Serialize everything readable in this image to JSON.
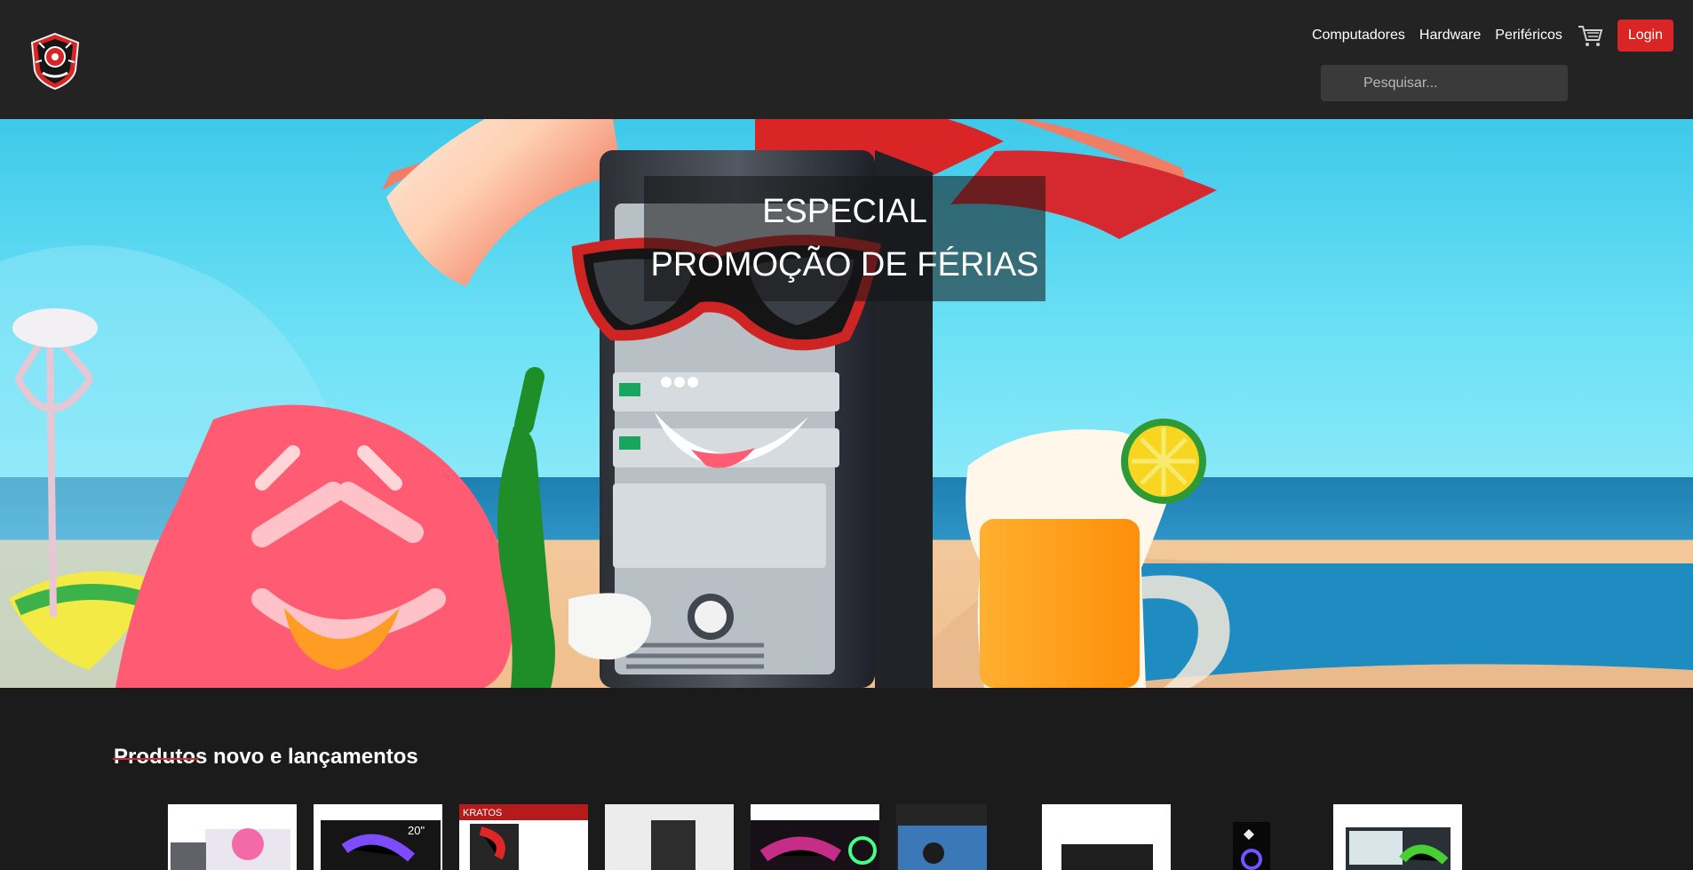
{
  "header": {
    "nav": [
      "Computadores",
      "Hardware",
      "Periféricos"
    ],
    "login_label": "Login",
    "search_placeholder": "Pesquisar..."
  },
  "hero": {
    "line1": "ESPECIAL",
    "line2": "PROMOÇÃO DE FÉRIAS"
  },
  "products": {
    "title": "Produtos novo e lançamentos"
  },
  "brand": {
    "accent": "#d92525",
    "dark": "#1b1b1b"
  },
  "icons": {
    "logo": "shield-logo-icon",
    "cart": "cart-icon",
    "search": "search-icon"
  }
}
